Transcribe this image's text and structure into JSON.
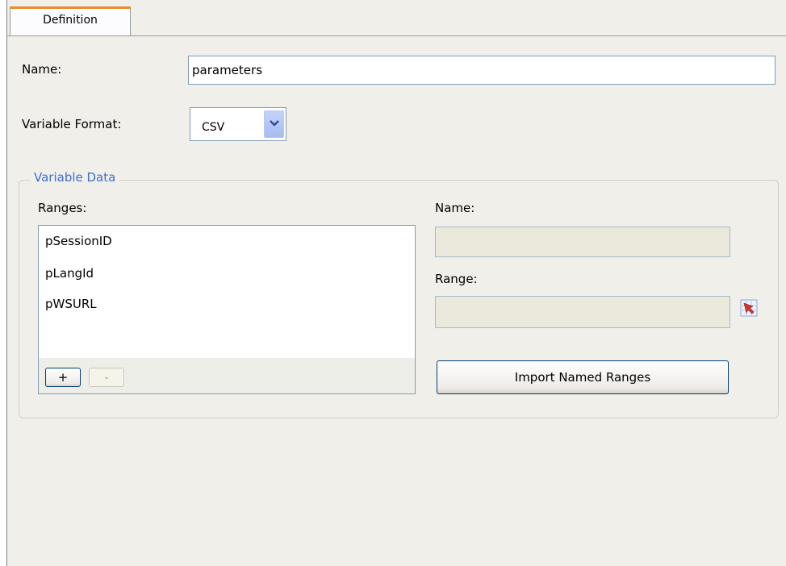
{
  "tabs": [
    {
      "label": "Definition"
    }
  ],
  "form": {
    "name_label": "Name:",
    "name_value": "parameters",
    "format_label": "Variable Format:",
    "format_value": "CSV"
  },
  "variable_data": {
    "title": "Variable Data",
    "ranges_label": "Ranges:",
    "ranges": [
      "pSessionID",
      "pLangId",
      "pWSURL"
    ],
    "add_label": "+",
    "remove_label": "-",
    "name_label": "Name:",
    "name_value": "",
    "range_label": "Range:",
    "range_value": "",
    "import_label": "Import Named Ranges"
  },
  "icons": {
    "dropdown": "chevron-down-icon",
    "range_picker": "range-picker-icon"
  },
  "colors": {
    "tab_accent": "#e68b2c",
    "group_title": "#3b6fd1",
    "panel_bg": "#f1efe9",
    "disabled_field": "#ebe8dc"
  }
}
